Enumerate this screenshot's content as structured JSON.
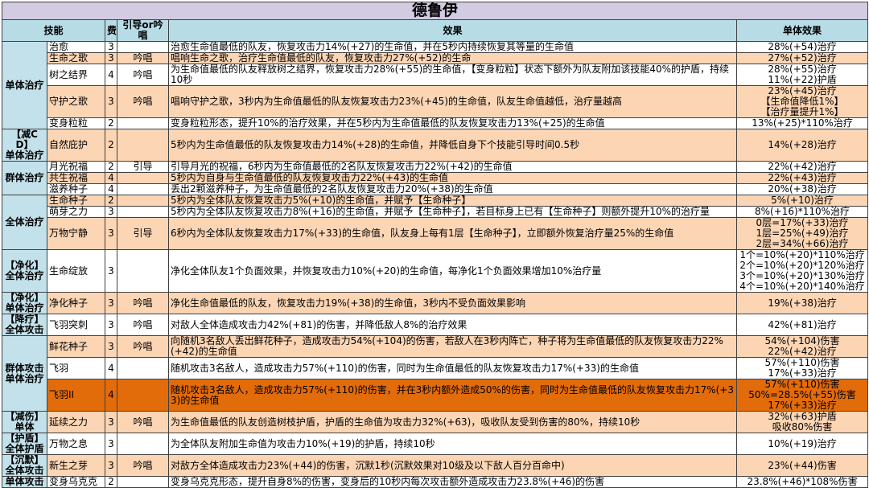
{
  "title": "德鲁伊",
  "columns": {
    "skill": "技能",
    "cost": "费",
    "channel": "引导or吟唱",
    "effect": "效果",
    "single": "单体效果"
  },
  "colors": {
    "title_bg": "#d3cbe1",
    "header_bg": "#b7dce6",
    "group_column_bg": "#c3e1ea",
    "row_peach": "#fcd5b4",
    "row_white": "#ffffff",
    "highlight_row": "#e26b0a",
    "border": "#404040"
  },
  "rows": [
    {
      "group": "单体治疗",
      "group_span": 5,
      "skill": "治愈",
      "cost": "3",
      "channel": "",
      "effect": "治愈生命值最低的队友，恢复攻击力14%(+27)的生命值，并在5秒内持续恢复其等量的生命值",
      "single": "28%(+54)治疗",
      "bg": "white"
    },
    {
      "skill": "生命之歌",
      "cost": "3",
      "channel": "吟唱",
      "effect": "唱响生命之歌，治疗生命值最低的队友，恢复攻击力27%(+52)的生命",
      "single": "27%(+52)治疗",
      "bg": "peach"
    },
    {
      "skill": "树之结界",
      "cost": "4",
      "channel": "吟唱",
      "effect": "为生命值最低的队友释放树之结界，恢复攻击力28%(+55)的生命值，【变身粒粒】状态下额外为队友附加该技能40%的护盾，持续10秒",
      "single": "28%(+55)治疗\n11%(+22)护盾",
      "bg": "white"
    },
    {
      "skill": "守护之歌",
      "cost": "3",
      "channel": "吟唱",
      "effect": "唱响守护之歌，3秒内为生命值最低的队友恢复攻击力23%(+45)的生命值，队友生命值越低，治疗量越高",
      "single": "23%(+45)治疗\n【生命值降低1%】\n【治疗量提升1%】",
      "bg": "peach"
    },
    {
      "skill": "变身粒粒",
      "cost": "2",
      "channel": "",
      "effect": "变身粒粒形态，提升10%的治疗效果，并在5秒内为生命值最低的队友恢复攻击力13%(+25)的生命值",
      "single": "13%(+25)*110%治疗",
      "bg": "white"
    },
    {
      "group": "【减CD】\n单体治疗",
      "group_span": 1,
      "skill": "自然庇护",
      "cost": "2",
      "channel": "",
      "effect": "5秒内为生命值最低的队友恢复攻击力14%(+28)的生命值，并降低自身下个技能引导时间0.5秒",
      "single": "14%(+28)治疗",
      "bg": "peach"
    },
    {
      "group": "群体治疗",
      "group_span": 3,
      "skill": "月光祝福",
      "cost": "2",
      "channel": "引导",
      "effect": "引导月光的祝福，6秒内为生命值最低的2名队友恢复攻击力22%(+42)的生命值",
      "single": "22%(+42)治疗",
      "bg": "white"
    },
    {
      "skill": "共生祝福",
      "cost": "4",
      "channel": "",
      "effect": "5秒内为自身与生命值最低的队友恢复攻击力22%(+43)的生命值",
      "single": "22%(+43)治疗",
      "bg": "peach"
    },
    {
      "skill": "滋养种子",
      "cost": "4",
      "channel": "",
      "effect": "丢出2颗滋养种子，为生命值最低的2名队友恢复攻击力20%(+38)的生命值",
      "single": "20%(+38)治疗",
      "bg": "white"
    },
    {
      "group": "全体治疗",
      "group_span": 3,
      "skill": "生命种子",
      "cost": "2",
      "channel": "",
      "effect": "5秒内为全体队友恢复攻击力5%(+10)的生命值，并赋予【生命种子】",
      "single": "5%(+10)治疗",
      "bg": "peach"
    },
    {
      "skill": "萌芽之力",
      "cost": "3",
      "channel": "",
      "effect": "5秒内为全体队友恢复攻击力8%(+16)的生命值，并赋予【生命种子】，若目标身上已有【生命种子】则额外提升10%的治疗量",
      "single": "8%(+16)*110%治疗",
      "bg": "white"
    },
    {
      "skill": "万物宁静",
      "cost": "3",
      "channel": "引导",
      "effect": "6秒内为全体队友恢复攻击力17%(+33)的生命值，队友身上每有1层【生命种子】，立即额外恢复治疗量25%的生命值",
      "single": "0层=17%(+33)治疗\n1层=25%(+49)治疗\n2层=34%(+66)治疗",
      "bg": "peach"
    },
    {
      "group": "【净化】\n全体治疗",
      "group_span": 1,
      "skill": "生命绽放",
      "cost": "3",
      "channel": "",
      "effect": "净化全体队友1个负面效果，并恢复攻击力10%(+20)的生命值，每净化1个负面效果增加10%治疗量",
      "single": "1个=10%(+20)*110%治疗\n2个=10%(+20)*120%治疗\n3个=10%(+20)*130%治疗\n4个=10%(+20)*140%治疗",
      "bg": "white"
    },
    {
      "group": "【净化】\n单体治疗",
      "group_span": 1,
      "skill": "净化种子",
      "cost": "3",
      "channel": "吟唱",
      "effect": "净化生命值最低的队友，恢复攻击力19%(+38)的生命值，3秒内不受负面效果影响",
      "single": "19%(+38)治疗",
      "bg": "peach"
    },
    {
      "group": "【降疗】\n全体攻击",
      "group_span": 1,
      "skill": "飞羽突刺",
      "cost": "3",
      "channel": "吟唱",
      "effect": "对敌人全体造成攻击力42%(+81)的伤害，并降低敌人8%的治疗效果",
      "single": "42%(+81)治疗",
      "bg": "white"
    },
    {
      "group": "群体攻击\n单体治疗",
      "group_span": 3,
      "skill": "鲜花种子",
      "cost": "3",
      "channel": "吟唱",
      "effect": "向随机3名敌人丢出鲜花种子，造成攻击力54%(+104)的伤害，若敌人在3秒内阵亡，种子将为生命值最低的队友恢复攻击力22%(+42)的生命值",
      "single": "54%(+104)伤害\n22%(+42)治疗",
      "bg": "peach"
    },
    {
      "skill": "飞羽",
      "cost": "4",
      "channel": "",
      "effect": "随机攻击3名敌人，造成攻击力57%(+110)的伤害，同时为生命值最低的队友恢复攻击力17%(+33)的生命值",
      "single": "57%(+110)伤害\n17%(+33)治疗",
      "bg": "white"
    },
    {
      "skill": "飞羽II",
      "cost": "4",
      "channel": "",
      "effect": "随机攻击3名敌人，造成攻击力57%(+110)的伤害，并在3秒内额外造成50%的伤害，同时为生命值最低的队友恢复攻击力17%(+33)的生命值",
      "single": "57%(+110)伤害\n50%=28.5%(+55)伤害\n17%(+33)治疗",
      "bg": "orange"
    },
    {
      "group": "【减伤】\n单体",
      "group_span": 1,
      "skill": "延续之力",
      "cost": "3",
      "channel": "吟唱",
      "effect": "为生命值最低的队友创造树枝护盾，护盾的生命值为攻击力32%(+63)，吸收队友受到伤害的80%，持续10秒",
      "single": "32%(+63)护盾\n吸收80%伤害",
      "bg": "peach"
    },
    {
      "group": "【护盾】\n全体护盾",
      "group_span": 1,
      "skill": "万物之息",
      "cost": "3",
      "channel": "",
      "effect": "为全体队友附加生命值为攻击力10%(+19)的护盾，持续10秒",
      "single": "10%(+19)治疗",
      "bg": "white"
    },
    {
      "group": "【沉默】\n全体攻击",
      "group_span": 1,
      "skill": "新生之芽",
      "cost": "3",
      "channel": "吟唱",
      "effect": "对敌方全体造成攻击力23%(+44)的伤害，沉默1秒(沉默效果对10级及以下敌人百分百命中)",
      "single": "23%(+44)伤害",
      "bg": "peach"
    },
    {
      "group": "单体攻击",
      "group_span": 1,
      "skill": "变身乌克克",
      "cost": "2",
      "channel": "",
      "effect": "变身乌克克形态，提升自身8%的伤害，变身后的10秒内每次攻击额外造成攻击力23.8%(+46)的伤害",
      "single": "23.8%(+46)*108%伤害",
      "bg": "white"
    }
  ]
}
